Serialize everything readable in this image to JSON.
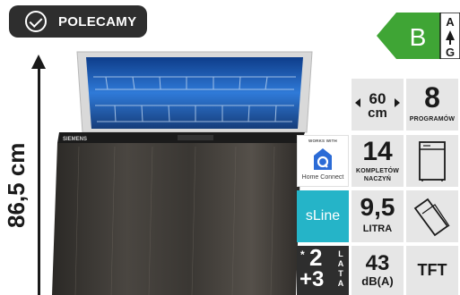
{
  "badge": {
    "label": "POLECAMY"
  },
  "energy": {
    "class": "B",
    "scale_top": "A",
    "scale_bottom": "G",
    "color": "#3fa535"
  },
  "dimensions": {
    "height": "86,5 cm"
  },
  "appliance": {
    "brand": "SIEMENS"
  },
  "specs": {
    "width_value": "60",
    "width_unit": "cm",
    "programs_value": "8",
    "programs_label": "PROGRAMÓW",
    "homeconnect_top": "WORKS WITH",
    "homeconnect_label": "Home Connect",
    "place_settings_value": "14",
    "place_settings_label_1": "KOMPLETÓW",
    "place_settings_label_2": "NACZYŃ",
    "series_label": "sLine",
    "series_color": "#25b4c8",
    "water_value": "9,5",
    "water_label": "LITRA",
    "warranty_star": "*",
    "warranty_base": "2",
    "warranty_extra": "+3",
    "warranty_label": "LATA",
    "noise_value": "43",
    "noise_unit": "dB(A)",
    "display_label": "TFT"
  }
}
